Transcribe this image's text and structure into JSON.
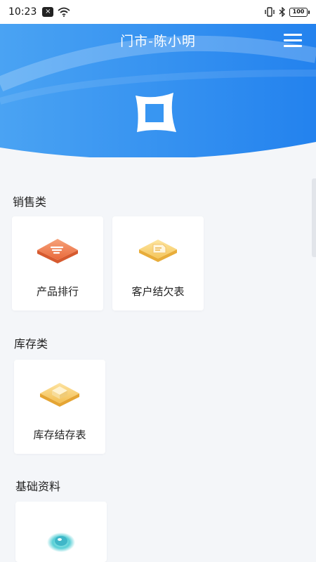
{
  "status_bar": {
    "time": "10:23",
    "notification_glyph": "×",
    "battery": "100"
  },
  "header": {
    "title": "门市-陈小明",
    "accent_color": "#2f8ff0"
  },
  "sections": [
    {
      "title": "销售类",
      "items": [
        {
          "label": "产品排行",
          "icon": "ranking-icon"
        },
        {
          "label": "客户结欠表",
          "icon": "customer-debt-icon"
        }
      ]
    },
    {
      "title": "库存类",
      "items": [
        {
          "label": "库存结存表",
          "icon": "inventory-icon"
        }
      ]
    },
    {
      "title": "基础资料",
      "items": [
        {
          "label": "",
          "icon": "basic-data-icon"
        }
      ]
    }
  ]
}
